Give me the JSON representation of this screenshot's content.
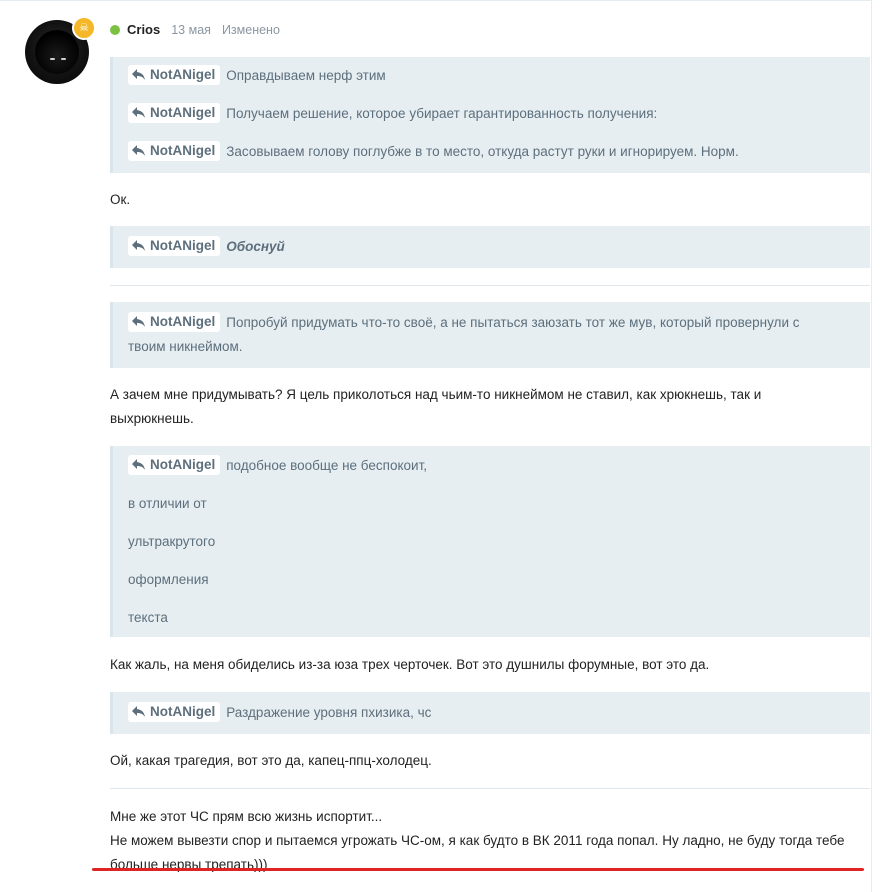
{
  "post": {
    "author": "Crios",
    "date": "13 мая",
    "edited": "Изменено"
  },
  "quotes": [
    {
      "ref": "NotANigel",
      "text": "Оправдываем нерф этим"
    },
    {
      "ref": "NotANigel",
      "text": "Получаем решение, которое убирает гарантированность получения:"
    },
    {
      "ref": "NotANigel",
      "text": "Засовываем голову поглубже в то место, откуда растут руки и игнорируем. Норм."
    },
    {
      "ref": "NotANigel",
      "text": "Обоснуй"
    },
    {
      "ref": "NotANigel",
      "text_line1": "Попробуй придумать что-то своё, а не пытаться заюзать тот же мув, который провернули с",
      "text_line2": "твоим никнеймом."
    },
    {
      "ref": "NotANigel",
      "lines": [
        "подобное вообще не беспокоит,",
        "в отличии от",
        "ультракрутого",
        "оформления",
        "текста"
      ]
    },
    {
      "ref": "NotANigel",
      "text": "Раздражение уровня пхизика, чс"
    }
  ],
  "replies": {
    "ok": "Ок.",
    "why_line1": "А зачем мне придумывать? Я цель приколоться над чьим-то никнеймом не ставил, как хрюкнешь, так и",
    "why_line2": "выхрюкнешь.",
    "pity": "Как жаль, на меня обиделись из-за юза трех черточек. Вот это душнилы форумные, вот это да.",
    "tragedy": "Ой, какая трагедия, вот это да, капец-ппц-холодец.",
    "final_line1": "Мне же этот ЧС прям всю жизнь испортит...",
    "final_line2": "Не можем вывезти спор и пытаемся угрожать ЧС-ом, я как будто в ВК 2011 года попал. Ну ладно, не буду тогда тебе",
    "final_line3": "больше нервы трепать)))"
  },
  "colors": {
    "quote_bg": "#e6eef2",
    "online": "#7cc242",
    "badge": "#f4b728",
    "underline": "#e02424"
  },
  "icons": [
    "reply-arrow-icon",
    "skull-badge-icon",
    "online-dot-icon"
  ]
}
